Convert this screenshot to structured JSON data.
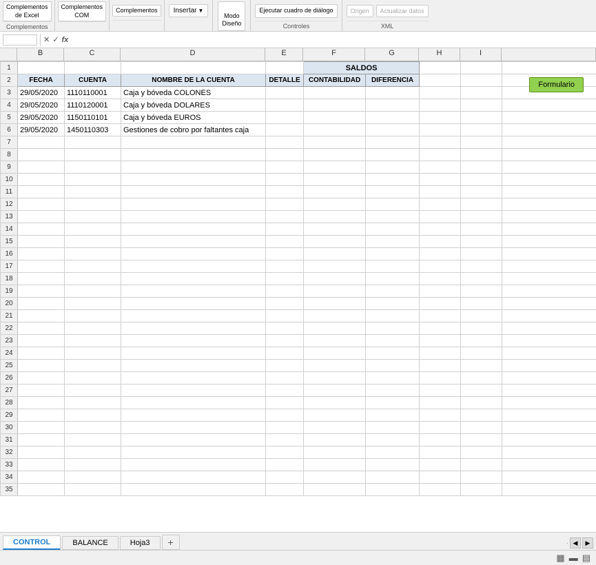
{
  "ribbon": {
    "groups": [
      {
        "id": "complementos-excel",
        "buttons": [
          "Complementos\nde Excel"
        ],
        "label": "Complementos"
      },
      {
        "id": "complementos-com",
        "buttons": [
          "Complementos\nCOM"
        ],
        "label": ""
      },
      {
        "id": "complementos3",
        "buttons": [
          "Complementos"
        ],
        "label": ""
      }
    ],
    "insert": {
      "label": "Insertar",
      "arrow": "▼"
    },
    "mode": {
      "label": "Modo\nDiseño"
    },
    "controls": {
      "label": "Ejecutar cuadro de diálogo",
      "group_label": "Controles"
    },
    "origin": {
      "label": "Origen",
      "group_label": "XML"
    },
    "xml": {
      "label": "Actualizar datos",
      "group_label": ""
    }
  },
  "formula_bar": {
    "cell_ref": "",
    "cancel_icon": "✕",
    "confirm_icon": "✓",
    "function_icon": "fx"
  },
  "columns": {
    "headers": [
      "B",
      "C",
      "D",
      "E",
      "F",
      "G",
      "H",
      "I"
    ]
  },
  "spreadsheet": {
    "header_row1": {
      "b": "",
      "c": "",
      "d": "",
      "e": "",
      "f": "SALDOS",
      "g": "",
      "h": "",
      "i": ""
    },
    "header_row2": {
      "b": "FECHA",
      "c": "CUENTA",
      "d": "NOMBRE DE LA CUENTA",
      "e": "DETALLE",
      "f": "CONTABILIDAD",
      "g": "DIFERENCIA",
      "h": "",
      "i": ""
    },
    "data_rows": [
      {
        "num": 3,
        "b": "29/05/2020",
        "c": "1110110001",
        "d": "Caja y bóveda COLONES",
        "e": "",
        "f": "",
        "g": "",
        "h": "",
        "i": ""
      },
      {
        "num": 4,
        "b": "29/05/2020",
        "c": "1110120001",
        "d": "Caja y bóveda DOLARES",
        "e": "",
        "f": "",
        "g": "",
        "h": "",
        "i": ""
      },
      {
        "num": 5,
        "b": "29/05/2020",
        "c": "1150110101",
        "d": "Caja y bóveda EUROS",
        "e": "",
        "f": "",
        "g": "",
        "h": "",
        "i": ""
      },
      {
        "num": 6,
        "b": "29/05/2020",
        "c": "1450110303",
        "d": "Gestiones de cobro por faltantes caja",
        "e": "",
        "f": "",
        "g": "",
        "h": "",
        "i": ""
      }
    ],
    "empty_rows": [
      7,
      8,
      9,
      10,
      11,
      12,
      13,
      14,
      15,
      16,
      17,
      18,
      19,
      20,
      21,
      22,
      23,
      24,
      25,
      26,
      27,
      28,
      29,
      30,
      31,
      32,
      33,
      34,
      35
    ]
  },
  "formulario_btn": "Formulario",
  "sheet_tabs": [
    {
      "id": "control",
      "label": "CONTROL",
      "active": true
    },
    {
      "id": "balance",
      "label": "BALANCE",
      "active": false
    },
    {
      "id": "hoja3",
      "label": "Hoja3",
      "active": false
    }
  ],
  "status_bar": {
    "icons": [
      "▦",
      "▬",
      "▤"
    ]
  },
  "colors": {
    "header_bg": "#dce6f1",
    "formulario_bg": "#92d050",
    "active_tab_color": "#1f7ccd"
  }
}
